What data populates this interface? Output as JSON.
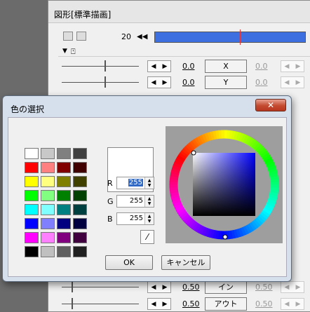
{
  "main_window": {
    "title": "図形[標準描画]",
    "frame_number": "20",
    "step_left_glyph": "◀◀",
    "step_right_glyph": "▶▶",
    "collapse_glyph": "▼",
    "arrow_left": "◀",
    "arrow_right": "▶",
    "params": [
      {
        "label": "X",
        "value": "0.0",
        "value2": "0.0"
      },
      {
        "label": "Y",
        "value": "0.0",
        "value2": "0.0"
      },
      {
        "label": "イン",
        "value": "0.50",
        "value2": "0.50"
      },
      {
        "label": "アウト",
        "value": "0.50",
        "value2": "0.50"
      }
    ]
  },
  "color_dialog": {
    "title": "色の選択",
    "close_glyph": "✕",
    "swatches": [
      "#ffffff",
      "#c8c8c8",
      "#808080",
      "#404040",
      "#ff0000",
      "#ff8080",
      "#800000",
      "#400000",
      "#ffff00",
      "#ffff80",
      "#808000",
      "#404000",
      "#00ff00",
      "#80ff80",
      "#008000",
      "#004000",
      "#00ffff",
      "#80ffff",
      "#008080",
      "#004040",
      "#0000ff",
      "#8080ff",
      "#000080",
      "#000040",
      "#ff00ff",
      "#ff80ff",
      "#800080",
      "#400040",
      "#000000",
      "#c0c0c0",
      "#606060",
      "#202020"
    ],
    "preview_color": "#ffffff",
    "r_label": "R",
    "g_label": "G",
    "b_label": "B",
    "r_value": "255",
    "g_value": "255",
    "b_value": "255",
    "spin_up": "▲",
    "spin_down": "▼",
    "eyedropper_glyph": "⁄",
    "ok_label": "OK",
    "cancel_label": "キャンセル"
  }
}
